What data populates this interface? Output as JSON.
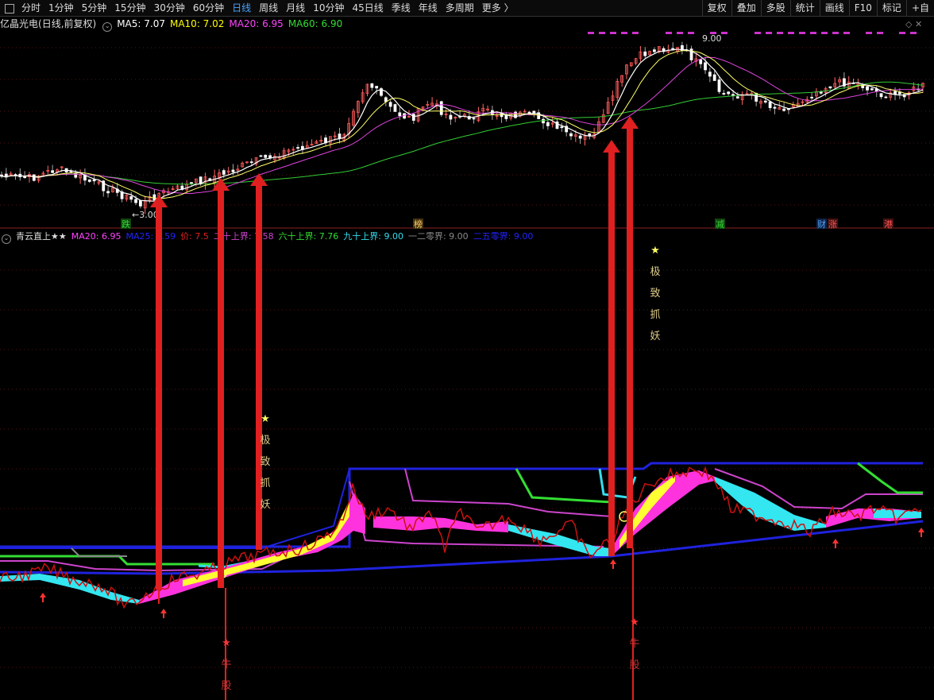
{
  "toolbar": {
    "periods": [
      {
        "label": "分时",
        "active": false
      },
      {
        "label": "1分钟",
        "active": false
      },
      {
        "label": "5分钟",
        "active": false
      },
      {
        "label": "15分钟",
        "active": false
      },
      {
        "label": "30分钟",
        "active": false
      },
      {
        "label": "60分钟",
        "active": false
      },
      {
        "label": "日线",
        "active": true
      },
      {
        "label": "周线",
        "active": false
      },
      {
        "label": "月线",
        "active": false
      },
      {
        "label": "10分钟",
        "active": false
      },
      {
        "label": "45日线",
        "active": false
      },
      {
        "label": "季线",
        "active": false
      },
      {
        "label": "年线",
        "active": false
      },
      {
        "label": "多周期",
        "active": false
      },
      {
        "label": "更多 〉",
        "active": false
      }
    ],
    "right_buttons": [
      "复权",
      "叠加",
      "多股",
      "统计",
      "画线",
      "F10",
      "标记",
      "+自"
    ]
  },
  "main_chart": {
    "stock_name": "亿晶光电",
    "mode": "(日线,前复权)",
    "ma": [
      {
        "label": "MA5: 7.07",
        "color": "#ffffff"
      },
      {
        "label": "MA10: 7.02",
        "color": "#ffff00"
      },
      {
        "label": "MA20: 6.95",
        "color": "#ff44ff"
      },
      {
        "label": "MA60: 6.90",
        "color": "#33dd33"
      }
    ],
    "high_label": "9.00",
    "low_label": "←3.00",
    "event_tags": [
      {
        "text": "跌",
        "color": "#33dd33",
        "bg": "#114411"
      },
      {
        "text": "榜",
        "color": "#ffcc66",
        "bg": "#443311"
      },
      {
        "text": "减",
        "color": "#33dd33",
        "bg": "#114411"
      },
      {
        "text": "财",
        "color": "#4aa3ff",
        "bg": "#112244"
      },
      {
        "text": "涨",
        "color": "#ff5555",
        "bg": "#441111"
      },
      {
        "text": "港",
        "color": "#ff5555",
        "bg": "#441111"
      }
    ]
  },
  "indicator": {
    "name": "青云直上★★",
    "legend": [
      {
        "label": "MA20: 6.95",
        "color": "#ff44ff"
      },
      {
        "label": "MA25: 6.59",
        "color": "#2222ff"
      },
      {
        "label": "价: 7.5",
        "color": "#dd2222"
      },
      {
        "label": "二十上界: 7.58",
        "color": "#cc44cc"
      },
      {
        "label": "六十上界: 7.76",
        "color": "#33dd33"
      },
      {
        "label": "九十上界: 9.00",
        "color": "#33ddee"
      },
      {
        "label": "一二零界: 9.00",
        "color": "#888888"
      },
      {
        "label": "二五零界: 9.00",
        "color": "#2222ff"
      }
    ],
    "signal_texts": {
      "jizhi": [
        "★",
        "极",
        "致",
        "抓",
        "妖"
      ],
      "niugu": [
        "★",
        "牛",
        "股"
      ]
    }
  }
}
